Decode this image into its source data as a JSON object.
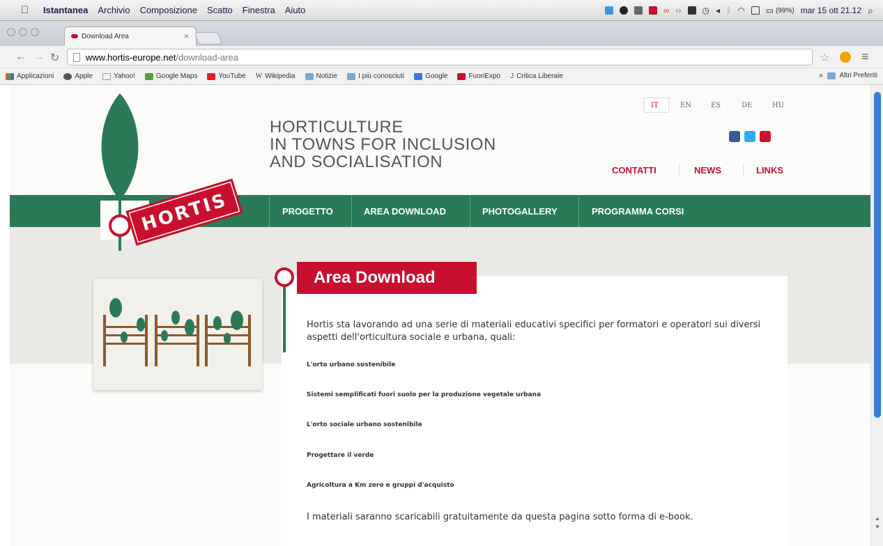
{
  "menubar": {
    "app": "Istantanea",
    "items": [
      "Archivio",
      "Composizione",
      "Scatto",
      "Finestra",
      "Aiuto"
    ],
    "battery": "(99%)",
    "clock": "mar 15 ott 21.12"
  },
  "browser": {
    "tab_title": "Download Area",
    "tab_close": "×",
    "url_domain": "www.hortis-europe.net",
    "url_path": "/download-area",
    "bookmarks": [
      "Applicazioni",
      "Apple",
      "Yahoo!",
      "Google Maps",
      "YouTube",
      "Wikipedia",
      "Notizie",
      "I più conosciuti",
      "Google",
      "FuoriExpo",
      "Critica Liberale"
    ],
    "bookmarks_more": "»",
    "bookmarks_other": "Altri Preferiti"
  },
  "site": {
    "logo_text": "HORTIS",
    "tagline": [
      "HORTICULTURE",
      "IN TOWNS FOR INCLUSION",
      "AND SOCIALISATION"
    ],
    "languages": [
      "IT",
      "EN",
      "ES",
      "DE",
      "HU"
    ],
    "top_links": [
      "CONTATTI",
      "NEWS",
      "LINKS"
    ],
    "nav": [
      "PROGETTO",
      "AREA DOWNLOAD",
      "PHOTOGALLERY",
      "PROGRAMMA CORSI"
    ],
    "page_title": "Area Download",
    "intro": "Hortis sta lavorando ad una serie di materiali educativi specifici per formatori e operatori sui diversi aspetti dell'orticultura sociale e urbana, quali:",
    "list": [
      "L'orto urbano sostenibile",
      "Sistemi semplificati fuori suolo per la produzione vegetale urbana",
      "L'orto sociale urbano sostenibile",
      "Progettare il verde",
      "Agricoltura a Km zero e gruppi d'acquisto"
    ],
    "outro": "I materiali saranno scaricabili gratuitamente da questa pagina sotto forma di e-book."
  },
  "colors": {
    "brand_green": "#2a7a58",
    "brand_red": "#c8102e",
    "scroll_blue": "#3b7dd8"
  }
}
